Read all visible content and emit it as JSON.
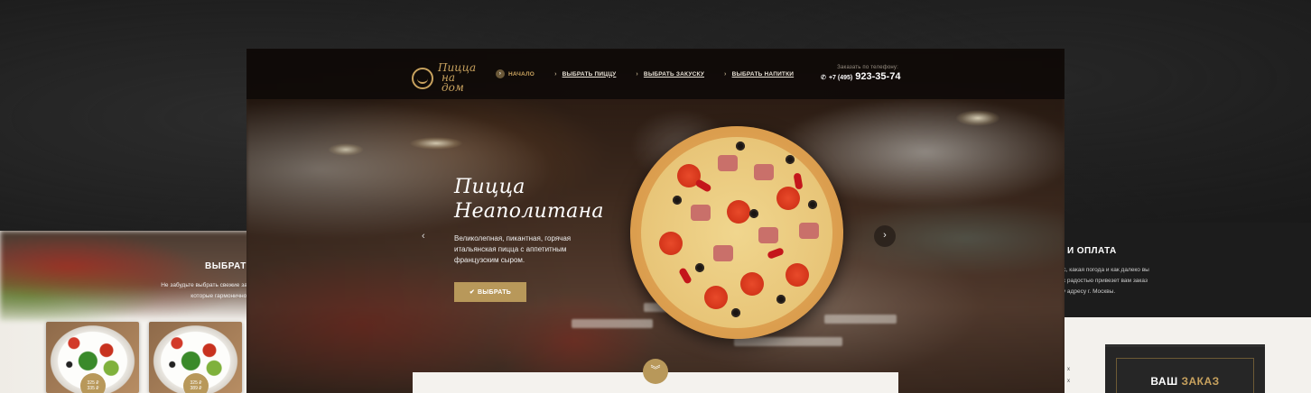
{
  "left_mockup": {
    "title": "ВЫБРАТЬ",
    "text_lines": [
      "Не забудьте выбрать свежие закуск",
      "которые гармонично доп"
    ],
    "cards": [
      {
        "name": "salad",
        "price_line1": "325 ₽",
        "price_line2": "335 ₽"
      },
      {
        "name": "salad",
        "price_line1": "325 ₽",
        "price_line2": "389 ₽"
      }
    ]
  },
  "right_mockup": {
    "title": "И ОПЛАТА",
    "text_lines": [
      "е час, какая погода и как далеко вы",
      "вка с радостью привезет вам заказ",
      "бому адресу г. Москвы."
    ],
    "order_word1": "ВАШ",
    "order_word2": "ЗАКАЗ",
    "side_lines": [
      "х",
      "х"
    ]
  },
  "header": {
    "logo_line1": "Пицца",
    "logo_line2": "на дом",
    "nav": [
      {
        "label": "НАЧАЛО",
        "active": true,
        "bullet": "›"
      },
      {
        "label": "ВЫБРАТЬ ПИЦЦУ",
        "active": false
      },
      {
        "label": "ВЫБРАТЬ ЗАКУСКУ",
        "active": false
      },
      {
        "label": "ВЫБРАТЬ НАПИТКИ",
        "active": false
      }
    ],
    "phone_caption": "Заказать по телефону:",
    "phone_code": "+7 (495)",
    "phone_number": "923-35-74"
  },
  "hero": {
    "title_line1": "Пицца",
    "title_line2": "Неаполитана",
    "description": "Великолепная, пикантная, горячая итальянская пицца с аппетитным французским сыром.",
    "button_label": "ВЫБРАТЬ"
  },
  "colors": {
    "accent": "#b8985a",
    "accent_text": "#c8a25e",
    "header_bg": "#0c0907"
  },
  "icons": {
    "phone": "phone-icon",
    "check": "check-icon",
    "prev": "chevron-left-icon",
    "next": "chevron-right-icon",
    "down": "double-chevron-down-icon"
  }
}
